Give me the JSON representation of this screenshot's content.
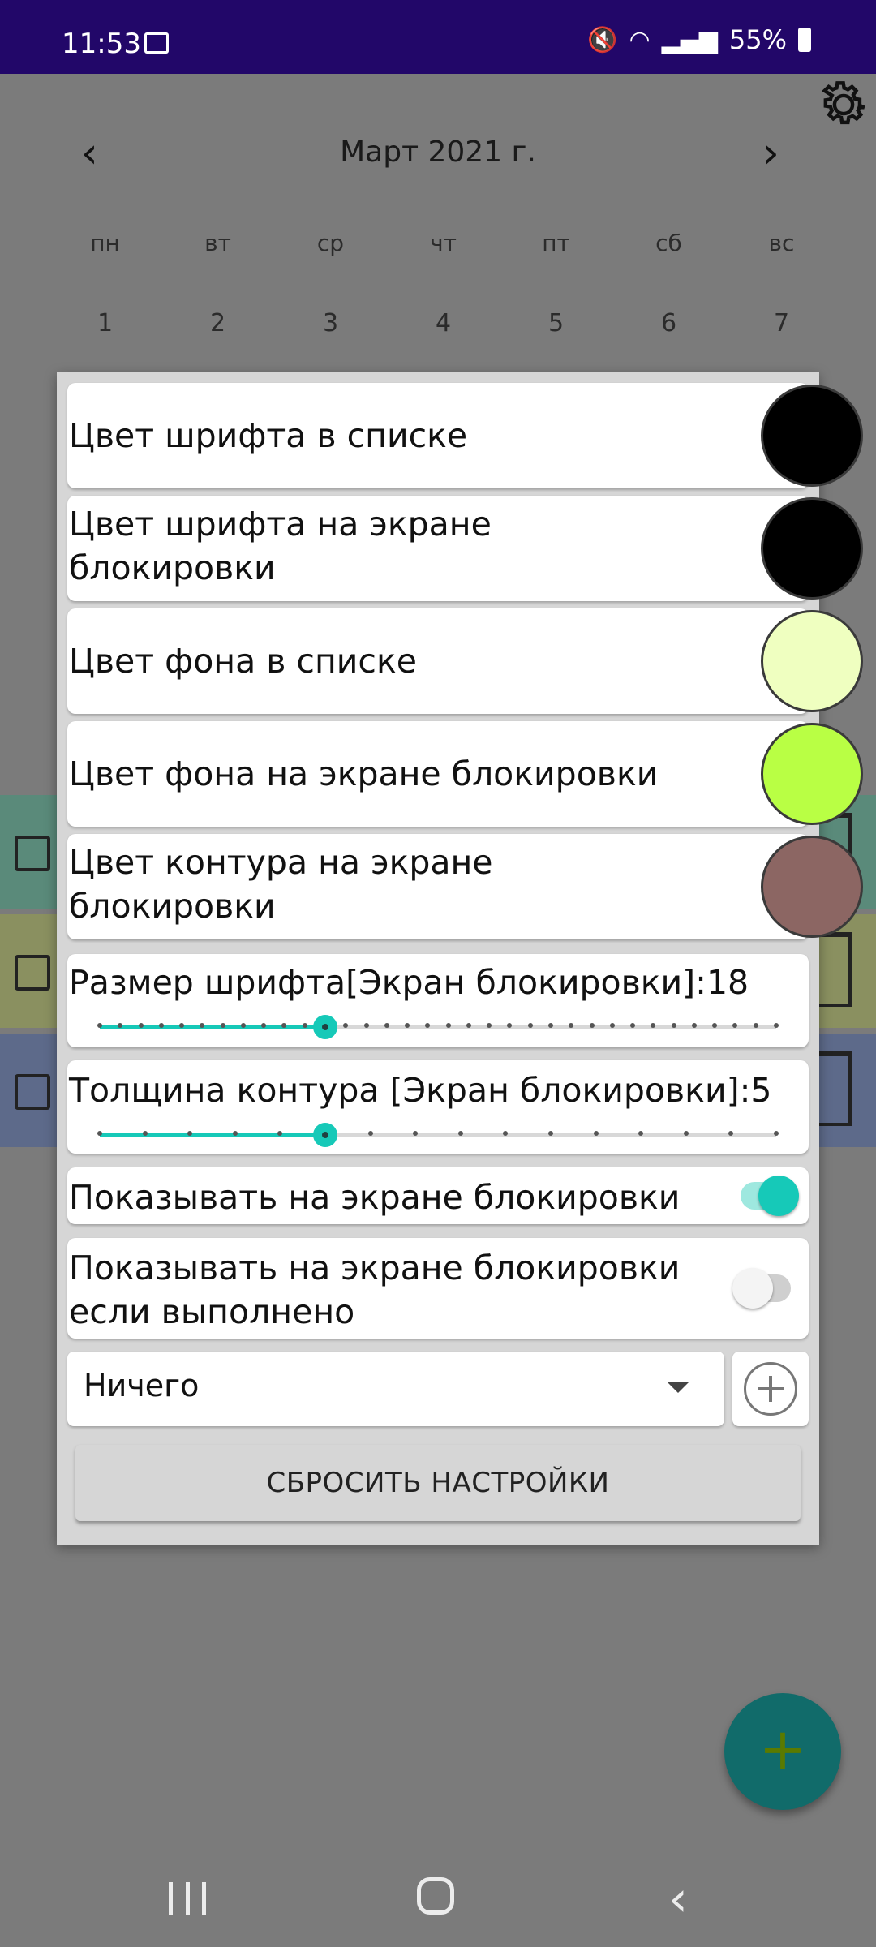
{
  "status_bar": {
    "time": "11:53",
    "battery": "55%"
  },
  "calendar": {
    "month_title": "Март 2021 г.",
    "prev_glyph": "‹",
    "next_glyph": "›",
    "weekdays": [
      "пн",
      "вт",
      "ср",
      "чт",
      "пт",
      "сб",
      "вс"
    ],
    "days": [
      "1",
      "2",
      "3",
      "4",
      "5",
      "6",
      "7"
    ],
    "task_row_colors": [
      "#5a8a7a",
      "#8a9060",
      "#5d6a8a"
    ]
  },
  "dialog": {
    "color_settings": [
      {
        "label": "Цвет шрифта в списке",
        "color": "#000000"
      },
      {
        "label": "Цвет шрифта на экране блокировки",
        "color": "#000000"
      },
      {
        "label": "Цвет фона в списке",
        "color": "#efffc0"
      },
      {
        "label": "Цвет фона на экране блокировки",
        "color": "#b9ff44"
      },
      {
        "label": "Цвет контура на экране блокировки",
        "color": "#8c6663"
      }
    ],
    "font_size_slider": {
      "label": "Размер шрифта[Экран блокировки]:18",
      "value": 18,
      "min": 7,
      "max": 40,
      "accent": "#16c9b8"
    },
    "outline_slider": {
      "label": "Толщина контура [Экран блокировки]:5",
      "value": 5,
      "min": 0,
      "max": 15,
      "accent": "#16c9b8"
    },
    "toggle_show_lockscreen": {
      "label": "Показывать на экране блокировки",
      "on": true
    },
    "toggle_show_if_done": {
      "label": "Показывать на экране блокировки если выполнено",
      "on": false
    },
    "dropdown": {
      "value": "Ничего"
    },
    "reset_button": "СБРОСИТЬ НАСТРОЙКИ"
  },
  "fab": {
    "glyph": "+"
  },
  "icons": [
    "gear-icon",
    "image-icon",
    "mute-icon",
    "wifi-icon",
    "signal-icon",
    "battery-icon",
    "add-circle-icon",
    "dropdown-caret-icon",
    "recents-icon",
    "home-icon",
    "back-icon"
  ]
}
